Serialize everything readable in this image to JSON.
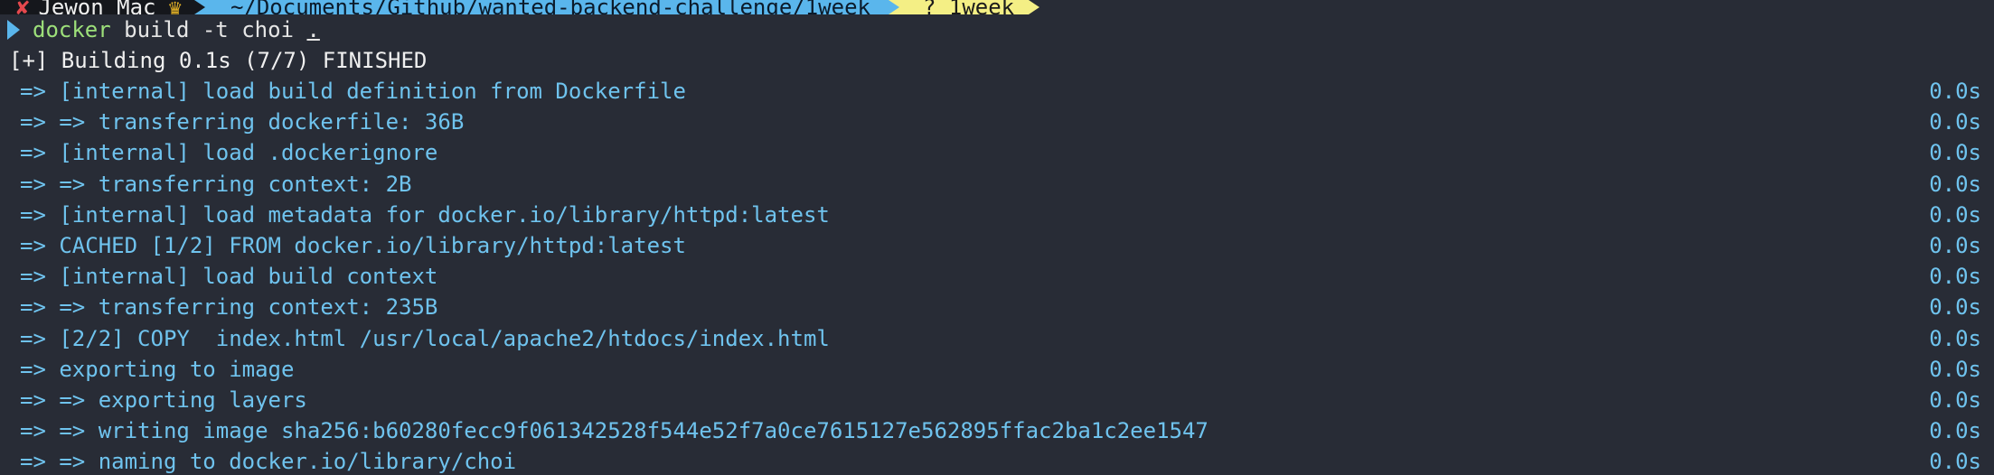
{
  "prompt_bar": {
    "context_label": "Jewon Mac",
    "directory": "~/Documents/Github/wanted-backend-challenge/1week",
    "git_branch": "? 1week",
    "colors": {
      "context_bg": "#15171c",
      "directory_bg": "#5ab6ec",
      "git_bg": "#f4ef85"
    }
  },
  "command": {
    "name": "docker",
    "args": " build -t choi ",
    "target": "."
  },
  "status": "[+] Building 0.1s (7/7) FINISHED",
  "steps": [
    {
      "text": "=> [internal] load build definition from Dockerfile",
      "time": "0.0s"
    },
    {
      "text": "=> => transferring dockerfile: 36B",
      "time": "0.0s"
    },
    {
      "text": "=> [internal] load .dockerignore",
      "time": "0.0s"
    },
    {
      "text": "=> => transferring context: 2B",
      "time": "0.0s"
    },
    {
      "text": "=> [internal] load metadata for docker.io/library/httpd:latest",
      "time": "0.0s"
    },
    {
      "text": "=> CACHED [1/2] FROM docker.io/library/httpd:latest",
      "time": "0.0s"
    },
    {
      "text": "=> [internal] load build context",
      "time": "0.0s"
    },
    {
      "text": "=> => transferring context: 235B",
      "time": "0.0s"
    },
    {
      "text": "=> [2/2] COPY  index.html /usr/local/apache2/htdocs/index.html",
      "time": "0.0s"
    },
    {
      "text": "=> exporting to image",
      "time": "0.0s"
    },
    {
      "text": "=> => exporting layers",
      "time": "0.0s"
    },
    {
      "text": "=> => writing image sha256:b60280fecc9f061342528f544e52f7a0ce7615127e562895ffac2ba1c2ee1547",
      "time": "0.0s"
    },
    {
      "text": "=> => naming to docker.io/library/choi",
      "time": "0.0s"
    }
  ],
  "icons": {
    "close": "close-icon",
    "user_badge": "badge-icon",
    "prompt": "prompt-caret-icon"
  }
}
